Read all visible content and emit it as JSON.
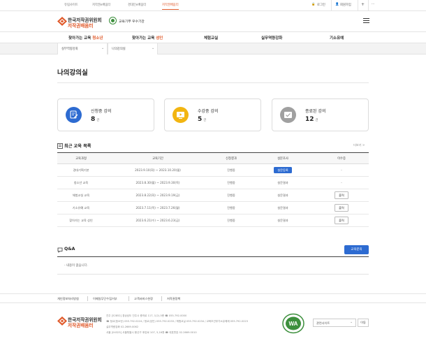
{
  "site_tabs": [
    "유림사이트",
    "저작권e배움터",
    "경대인e배움터",
    "저작권배움터"
  ],
  "active_site_tab": 3,
  "util": {
    "login": "로그인",
    "signup": "회원가입",
    "plus": "+",
    "more": "···"
  },
  "logo": {
    "line1": "한국저작권위원회",
    "line2": "저작권배움터"
  },
  "badge": {
    "text": "교육기부 우수기관"
  },
  "nav": [
    {
      "prefix": "찾아가는 교육 ",
      "highlight": "청소년"
    },
    {
      "prefix": "찾아가는 교육 ",
      "highlight": "성인"
    },
    {
      "prefix": "체험교실",
      "highlight": ""
    },
    {
      "prefix": "실무역량강화",
      "highlight": ""
    },
    {
      "prefix": "기소유예",
      "highlight": ""
    }
  ],
  "breadcrumb": {
    "level1": "실무역량강화",
    "level2": "나의강의실"
  },
  "page_title": "나의강의실",
  "cards": [
    {
      "label": "신청중 강의",
      "value": "8",
      "unit": "건",
      "color": "#2d6bd1"
    },
    {
      "label": "수강중 강의",
      "value": "5",
      "unit": "건",
      "color": "#f2b511"
    },
    {
      "label": "종료된 강의",
      "value": "12",
      "unit": "건",
      "color": "#a0a0a0"
    }
  ],
  "recent": {
    "title": "최근 교육 목록",
    "more": "더보기 >",
    "columns": [
      "교육과정",
      "교육기간",
      "신청결과",
      "설문조사",
      "이수증"
    ],
    "rows": [
      {
        "course": "경대기획기본",
        "period": "2023.9.10(화) ~ 2023.10.20(월)",
        "result": "진행중",
        "survey": "설문등록",
        "survey_type": "primary",
        "cert": "-",
        "cert_type": "text"
      },
      {
        "course": "청소년 교육",
        "period": "2023.8.30(월) ~ 2023.9.30(목)",
        "result": "진행중",
        "survey": "설문결과",
        "survey_type": "text",
        "cert": "-",
        "cert_type": "text"
      },
      {
        "course": "체험교실 교육",
        "period": "2023.8.22(화) ~ 2023.9.19(금)",
        "result": "진행중",
        "survey": "설문결과",
        "survey_type": "text",
        "cert": "출력",
        "cert_type": "button"
      },
      {
        "course": "기소유예 교육",
        "period": "2023.7.11(목) ~ 2023.7.26(월)",
        "result": "진행중",
        "survey": "설문결과",
        "survey_type": "text",
        "cert": "출력",
        "cert_type": "button"
      },
      {
        "course": "찾아가는 교육 성인",
        "period": "2023.6.21(수) ~ 2023.6.23(금)",
        "result": "진행중",
        "survey": "설문결과",
        "survey_type": "text",
        "cert": "출력",
        "cert_type": "button"
      }
    ]
  },
  "qna": {
    "title": "Q&A",
    "button": "교육문의",
    "empty": "- 내용이 없습니다."
  },
  "footer": {
    "links": [
      "개인정보처리방침",
      "이메일무단수집거부",
      "고객서비스헌장",
      "저작권정책"
    ],
    "logo1": "한국저작권위원회",
    "logo2": "저작권배움터",
    "addr": [
      "진주 [52852] 경상남도 진주시 충의로 117, 1(2)-5층  ☎ 055-792-0000",
      "☎ 청교(청소년) 055.792.0224 / 청교(성인) 055.792.0233 / 체험교실 055.792.0234 / 교육조건부기소유예제 055.792.0223",
      "  실무역량강화 02.2669.0062",
      "서울 [04323] 서울특별시 용산구 후암로 107, 5,16층  ☎ 대표번호 02.2669.0010"
    ],
    "wa_label": "WA",
    "select_text": "관련사이트",
    "go_button": "이동"
  }
}
